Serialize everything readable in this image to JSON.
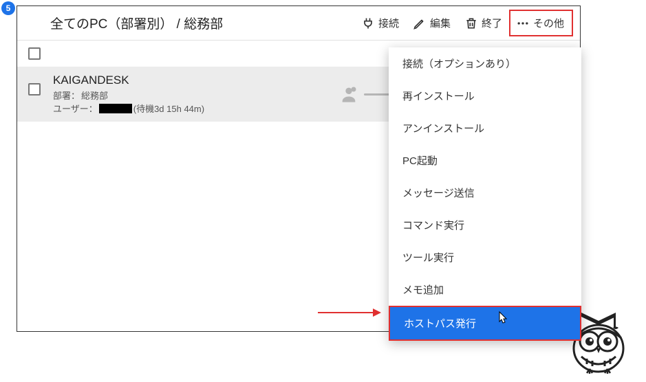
{
  "step_number": "5",
  "breadcrumb": "全てのPC（部署別） / 総務部",
  "toolbar": {
    "connect": "接続",
    "edit": "編集",
    "end": "終了",
    "other": "その他"
  },
  "row": {
    "name": "KAIGANDESK",
    "dept_label": "部署：",
    "dept_value": "総務部",
    "user_label": "ユーザー：",
    "wait_suffix": "(待機3d 15h 44m)"
  },
  "menu": {
    "items": [
      "接続（オプションあり）",
      "再インストール",
      "アンインストール",
      "PC起動",
      "メッセージ送信",
      "コマンド実行",
      "ツール実行",
      "メモ追加",
      "ホストパス発行"
    ],
    "selected_index": 8
  }
}
